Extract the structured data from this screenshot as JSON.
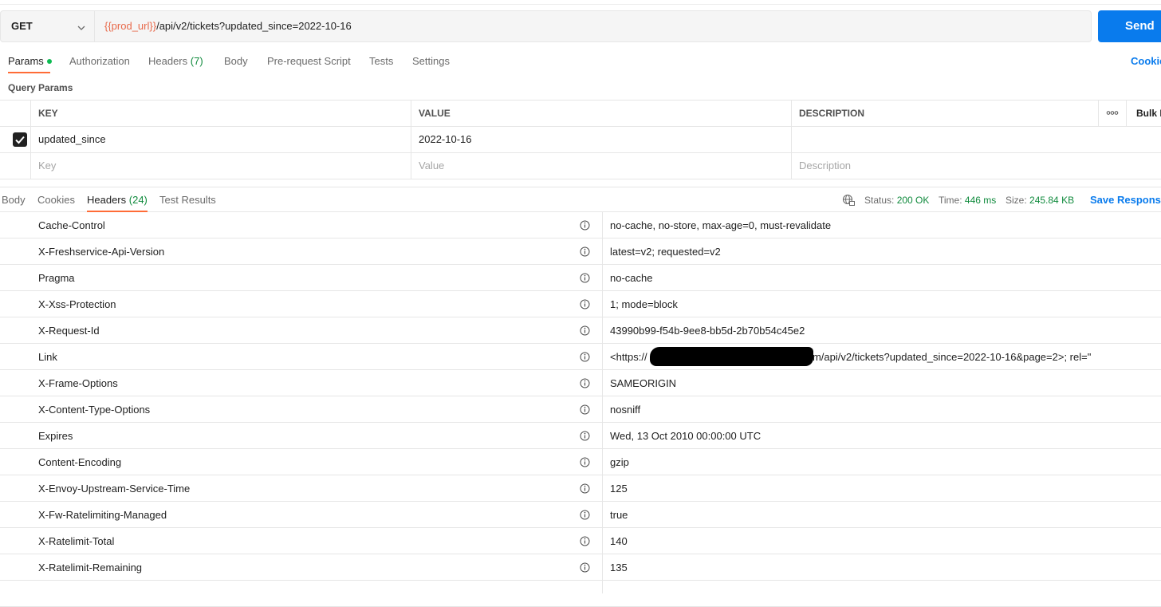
{
  "request": {
    "method": "GET",
    "url_variable": "{{prod_url}}",
    "url_path": "/api/v2/tickets?updated_since=2022-10-16",
    "send_label": "Send"
  },
  "request_tabs": {
    "params": "Params",
    "authorization": "Authorization",
    "headers": "Headers",
    "headers_count": "(7)",
    "body": "Body",
    "prerequest": "Pre-request Script",
    "tests": "Tests",
    "settings": "Settings",
    "cookies": "Cookies"
  },
  "query_params": {
    "title": "Query Params",
    "columns": {
      "key": "KEY",
      "value": "VALUE",
      "description": "DESCRIPTION"
    },
    "bulk_edit": "Bulk E",
    "rows": [
      {
        "key": "updated_since",
        "value": "2022-10-16",
        "description": "",
        "enabled": true
      }
    ],
    "placeholders": {
      "key": "Key",
      "value": "Value",
      "description": "Description"
    }
  },
  "response": {
    "tabs": {
      "body": "Body",
      "cookies": "Cookies",
      "headers": "Headers",
      "headers_count": "(24)",
      "test_results": "Test Results"
    },
    "status_label": "Status:",
    "status_value": "200 OK",
    "time_label": "Time:",
    "time_value": "446 ms",
    "size_label": "Size:",
    "size_value": "245.84 KB",
    "save_response": "Save Response",
    "headers": [
      {
        "key": "Cache-Control",
        "value": "no-cache, no-store, max-age=0, must-revalidate"
      },
      {
        "key": "X-Freshservice-Api-Version",
        "value": "latest=v2; requested=v2"
      },
      {
        "key": "Pragma",
        "value": "no-cache"
      },
      {
        "key": "X-Xss-Protection",
        "value": "1; mode=block"
      },
      {
        "key": "X-Request-Id",
        "value": "43990b99-f54b-9ee8-bb5d-2b70b54c45e2"
      },
      {
        "key": "Link",
        "value_prefix": "<https://",
        "value_suffix": ".com/api/v2/tickets?updated_since=2022-10-16&page=2>; rel=\""
      },
      {
        "key": "X-Frame-Options",
        "value": "SAMEORIGIN"
      },
      {
        "key": "X-Content-Type-Options",
        "value": "nosniff"
      },
      {
        "key": "Expires",
        "value": "Wed, 13 Oct 2010 00:00:00 UTC"
      },
      {
        "key": "Content-Encoding",
        "value": "gzip"
      },
      {
        "key": "X-Envoy-Upstream-Service-Time",
        "value": "125"
      },
      {
        "key": "X-Fw-Ratelimiting-Managed",
        "value": "true"
      },
      {
        "key": "X-Ratelimit-Total",
        "value": "140"
      },
      {
        "key": "X-Ratelimit-Remaining",
        "value": "135"
      }
    ]
  },
  "colors": {
    "accent": "#ff6c37",
    "primary": "#097bed",
    "success": "#0f8a3c",
    "variable": "#e8694a"
  },
  "icons": {
    "method_dropdown": "chevron-down-icon",
    "param_enabled": "checkbox-checked-icon",
    "more_options": "more-horizontal-icon",
    "network": "globe-icon",
    "header_info": "info-icon"
  }
}
